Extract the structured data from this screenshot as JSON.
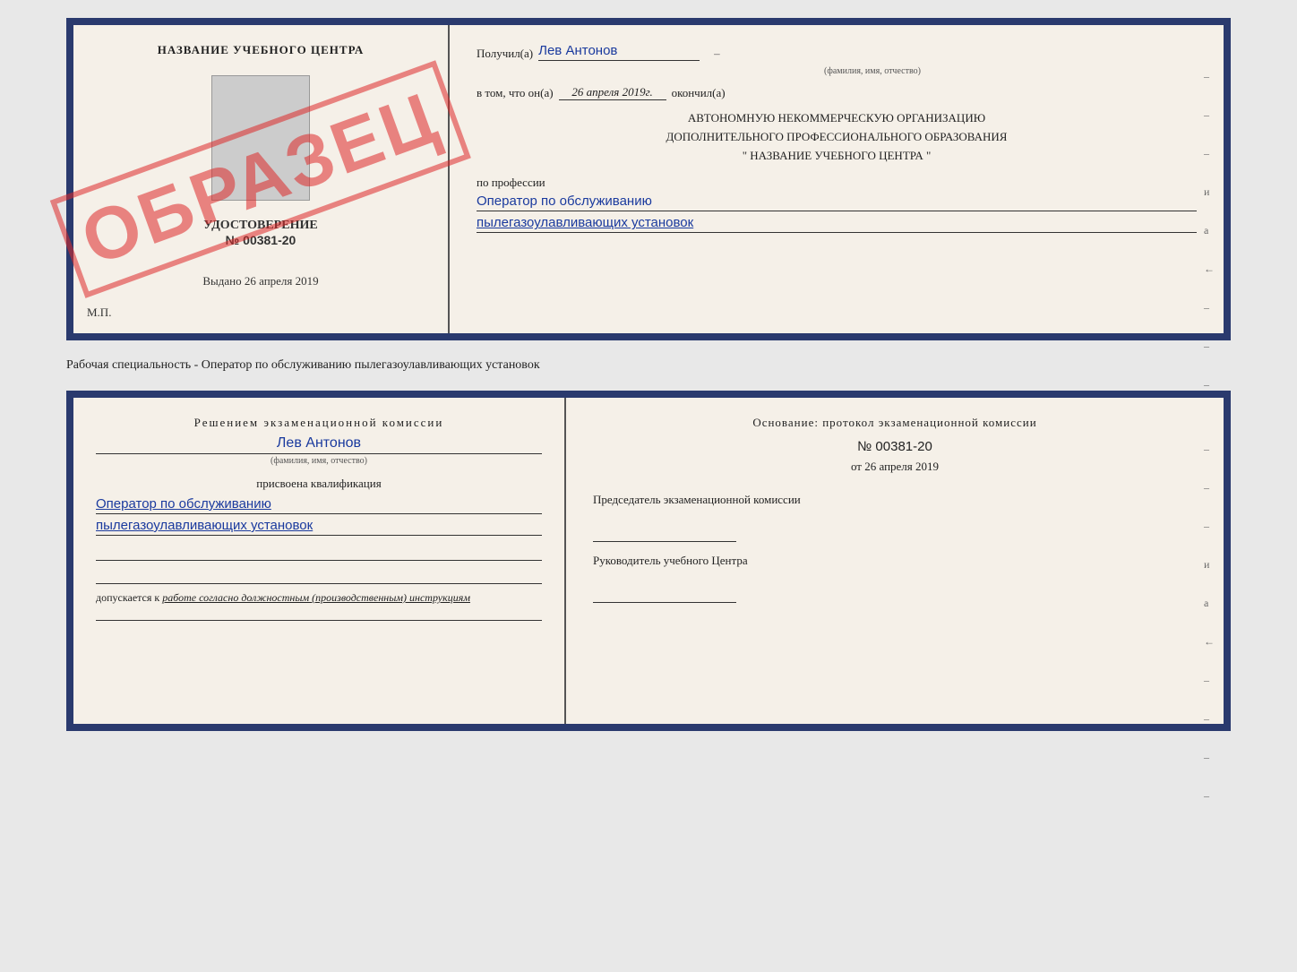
{
  "top": {
    "left": {
      "center_name": "НАЗВАНИЕ УЧЕБНОГО ЦЕНТРА",
      "udostoverenie": "УДОСТОВЕРЕНИЕ",
      "number": "№ 00381-20",
      "vydano_label": "Выдано",
      "vydano_date": "26 апреля 2019",
      "mp_label": "М.П.",
      "obrazec": "ОБРАЗЕЦ"
    },
    "right": {
      "poluchil_label": "Получил(а)",
      "poluchil_name": "Лев Антонов",
      "fio_sub": "(фамилия, имя, отчество)",
      "vtom_label": "в том, что он(а)",
      "vtom_date": "26 апреля 2019г.",
      "okonchil_label": "окончил(а)",
      "org_line1": "АВТОНОМНУЮ НЕКОММЕРЧЕСКУЮ ОРГАНИЗАЦИЮ",
      "org_line2": "ДОПОЛНИТЕЛЬНОГО ПРОФЕССИОНАЛЬНОГО ОБРАЗОВАНИЯ",
      "org_name": "\" НАЗВАНИЕ УЧЕБНОГО ЦЕНТРА \"",
      "po_professii": "по профессии",
      "profession1": "Оператор по обслуживанию",
      "profession2": "пылегазоулавливающих установок"
    }
  },
  "middle_text": "Рабочая специальность - Оператор по обслуживанию пылегазоулавливающих установок",
  "bottom": {
    "left": {
      "resheniem_title": "Решением экзаменационной комиссии",
      "name": "Лев Антонов",
      "fio_sub": "(фамилия, имя, отчество)",
      "prisvoena": "присвоена квалификация",
      "qual1": "Оператор по обслуживанию",
      "qual2": "пылегазоулавливающих установок",
      "dopuskaetsya_prefix": "допускается к",
      "dopuskaetsya_suffix": "работе согласно должностным (производственным) инструкциям"
    },
    "right": {
      "osnovanie": "Основание: протокол экзаменационной комиссии",
      "number": "№ 00381-20",
      "ot_prefix": "от",
      "ot_date": "26 апреля 2019",
      "predsedatel_title": "Председатель экзаменационной комиссии",
      "rukovoditel_title": "Руководитель учебного Центра"
    }
  },
  "dashes": [
    "-",
    "-",
    "-",
    "и",
    "а",
    "←",
    "-",
    "-",
    "-",
    "-"
  ]
}
